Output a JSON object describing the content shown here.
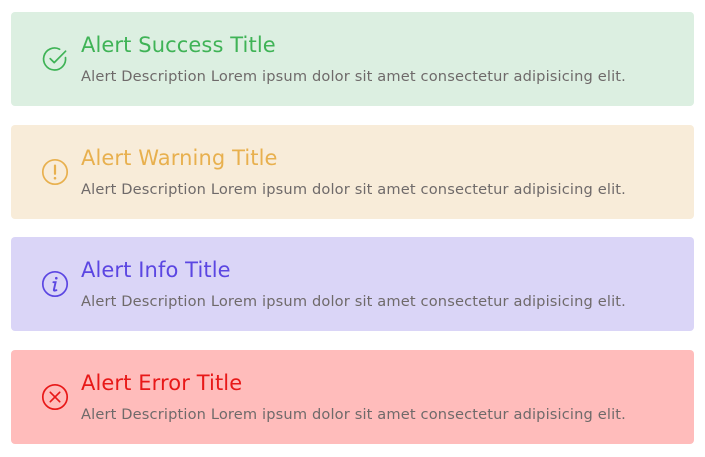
{
  "alerts": [
    {
      "type": "success",
      "icon": "check-circle-icon",
      "title": "Alert Success Title",
      "description": "Alert Description Lorem ipsum dolor sit amet consectetur adipisicing elit.",
      "background": "#dcefe1",
      "accent": "#3fb356"
    },
    {
      "type": "warning",
      "icon": "exclamation-circle-icon",
      "title": "Alert Warning Title",
      "description": "Alert Description Lorem ipsum dolor sit amet consectetur adipisicing elit.",
      "background": "#f8ecd9",
      "accent": "#e8b04e"
    },
    {
      "type": "info",
      "icon": "info-circle-icon",
      "title": "Alert Info Title",
      "description": "Alert Description Lorem ipsum dolor sit amet consectetur adipisicing elit.",
      "background": "#dad5f7",
      "accent": "#5b46e2"
    },
    {
      "type": "error",
      "icon": "close-circle-icon",
      "title": "Alert Error Title",
      "description": "Alert Description Lorem ipsum dolor sit amet consectetur adipisicing elit.",
      "background": "#ffbcbb",
      "accent": "#e81818"
    }
  ]
}
